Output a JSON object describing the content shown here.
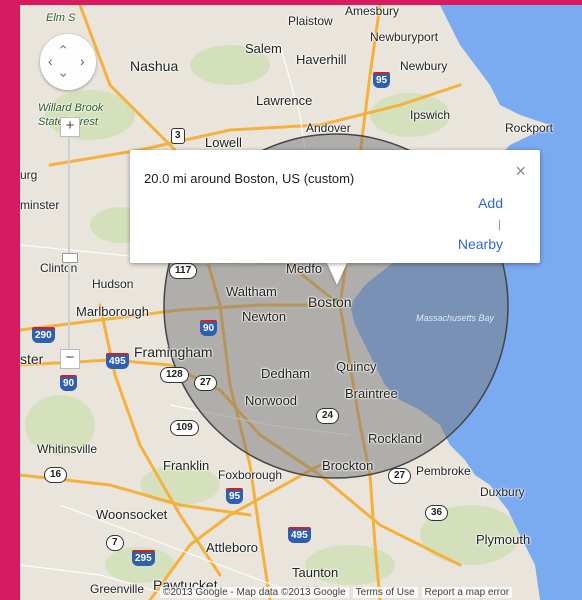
{
  "map": {
    "places": {
      "amesbury": "Amesbury",
      "plaistow": "Plaistow",
      "elm": "Elm S",
      "newburyport": "Newburyport",
      "salem": "Salem",
      "haverhill": "Haverhill",
      "nashua": "Nashua",
      "newbury": "Newbury",
      "willard": "Willard Brook",
      "state_forest": "State Forest",
      "lawrence": "Lawrence",
      "ipswich": "Ipswich",
      "lowell": "Lowell",
      "andover": "Andover",
      "rockport": "Rockport",
      "urg": "urg",
      "minster": "minster",
      "clinton": "Clinton",
      "hudson": "Hudson",
      "medford": "Medfo",
      "waltham": "Waltham",
      "boston": "Boston",
      "marlborough": "Marlborough",
      "newton": "Newton",
      "massachusetts_bay": "Massachusetts Bay",
      "ster": "ster",
      "framingham": "Framingham",
      "quincy": "Quincy",
      "dedham": "Dedham",
      "braintree": "Braintree",
      "norwood": "Norwood",
      "rockland": "Rockland",
      "whitinsville": "Whitinsville",
      "franklin": "Franklin",
      "foxborough": "Foxborough",
      "brockton": "Brockton",
      "pembroke": "Pembroke",
      "duxbury": "Duxbury",
      "woonsocket": "Woonsocket",
      "attleboro": "Attleboro",
      "plymouth": "Plymouth",
      "taunton": "Taunton",
      "greenville": "Greenville",
      "pawtucket": "Pawtucket"
    },
    "shields": {
      "i95_top": "95",
      "us3": "3",
      "s117": "117",
      "i90_a": "90",
      "i290": "290",
      "i495": "495",
      "i90_b": "90",
      "s128": "128",
      "s27_a": "27",
      "s109": "109",
      "s24": "24",
      "s16": "16",
      "i95_b": "95",
      "s27_b": "27",
      "s36": "36",
      "i495_b": "495",
      "s7": "7",
      "i295": "295"
    },
    "circle": {
      "center": "Boston",
      "radius_mi": 20.0
    }
  },
  "controls": {
    "pan_up": "‹",
    "pan_down": "›",
    "pan_left": "‹",
    "pan_right": "›",
    "zoom_in": "+",
    "zoom_out": "−"
  },
  "popup": {
    "title": "20.0 mi around Boston, US (custom)",
    "close": "×",
    "add": "Add",
    "separator": "|",
    "nearby": "Nearby"
  },
  "footer": {
    "copyright": "©2013 Google - Map data ©2013 Google",
    "terms": "Terms of Use",
    "report": "Report a map error"
  },
  "colors": {
    "frame": "#d81b60",
    "land": "#e9e5dc",
    "water": "#7aaaf0",
    "highway": "#f5b13c",
    "circle_fill": "#777777",
    "link": "#3367d6"
  }
}
